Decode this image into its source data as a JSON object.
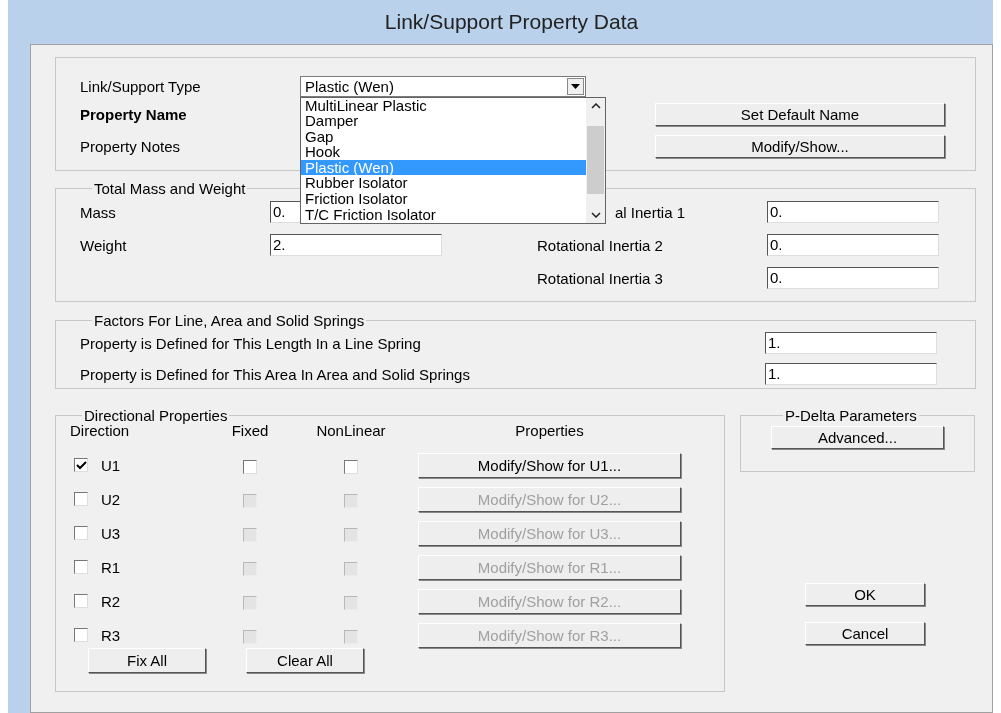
{
  "window": {
    "title": "Link/Support Property Data"
  },
  "type_field": {
    "label": "Link/Support Type",
    "value": "Plastic (Wen)",
    "expanded": true,
    "options": [
      {
        "label": "MultiLinear Plastic",
        "selected": false
      },
      {
        "label": "Damper",
        "selected": false
      },
      {
        "label": "Gap",
        "selected": false
      },
      {
        "label": "Hook",
        "selected": false
      },
      {
        "label": "Plastic (Wen)",
        "selected": true
      },
      {
        "label": "Rubber Isolator",
        "selected": false
      },
      {
        "label": "Friction Isolator",
        "selected": false
      },
      {
        "label": "T/C Friction Isolator",
        "selected": false
      }
    ]
  },
  "property_name": {
    "label": "Property Name"
  },
  "property_notes": {
    "label": "Property Notes"
  },
  "name_buttons": [
    "Set Default Name",
    "Modify/Show..."
  ],
  "mass_group": {
    "title": "Total Mass and Weight",
    "left_fields": [
      {
        "label": "Mass",
        "value": "0."
      },
      {
        "label": "Weight",
        "value": "2."
      }
    ],
    "right_fields": [
      {
        "label": "al Inertia 1",
        "value": "0."
      },
      {
        "label": "Rotational Inertia 2",
        "value": "0."
      },
      {
        "label": "Rotational Inertia 3",
        "value": "0."
      }
    ]
  },
  "factors_group": {
    "title": "Factors For Line, Area and Solid Springs",
    "fields": [
      {
        "label": "Property is Defined for This Length In a Line Spring",
        "value": "1."
      },
      {
        "label": "Property is Defined for This Area In Area and Solid Springs",
        "value": "1."
      }
    ]
  },
  "directional": {
    "title": "Directional Properties",
    "columns": [
      "Direction",
      "Fixed",
      "NonLinear",
      "Properties"
    ],
    "rows": [
      {
        "direction": "U1",
        "checked": true,
        "fixed": false,
        "nonlinear": false,
        "button": "Modify/Show for U1...",
        "disabled": false
      },
      {
        "direction": "U2",
        "checked": false,
        "fixed": false,
        "nonlinear": false,
        "button": "Modify/Show for U2...",
        "disabled": true
      },
      {
        "direction": "U3",
        "checked": false,
        "fixed": false,
        "nonlinear": false,
        "button": "Modify/Show for U3...",
        "disabled": true
      },
      {
        "direction": "R1",
        "checked": false,
        "fixed": false,
        "nonlinear": false,
        "button": "Modify/Show for R1...",
        "disabled": true
      },
      {
        "direction": "R2",
        "checked": false,
        "fixed": false,
        "nonlinear": false,
        "button": "Modify/Show for R2...",
        "disabled": true
      },
      {
        "direction": "R3",
        "checked": false,
        "fixed": false,
        "nonlinear": false,
        "button": "Modify/Show for R3...",
        "disabled": true
      }
    ],
    "buttons": [
      "Fix All",
      "Clear All"
    ]
  },
  "p_delta": {
    "title": "P-Delta Parameters",
    "button": "Advanced..."
  },
  "dialog_buttons": [
    "OK",
    "Cancel"
  ]
}
